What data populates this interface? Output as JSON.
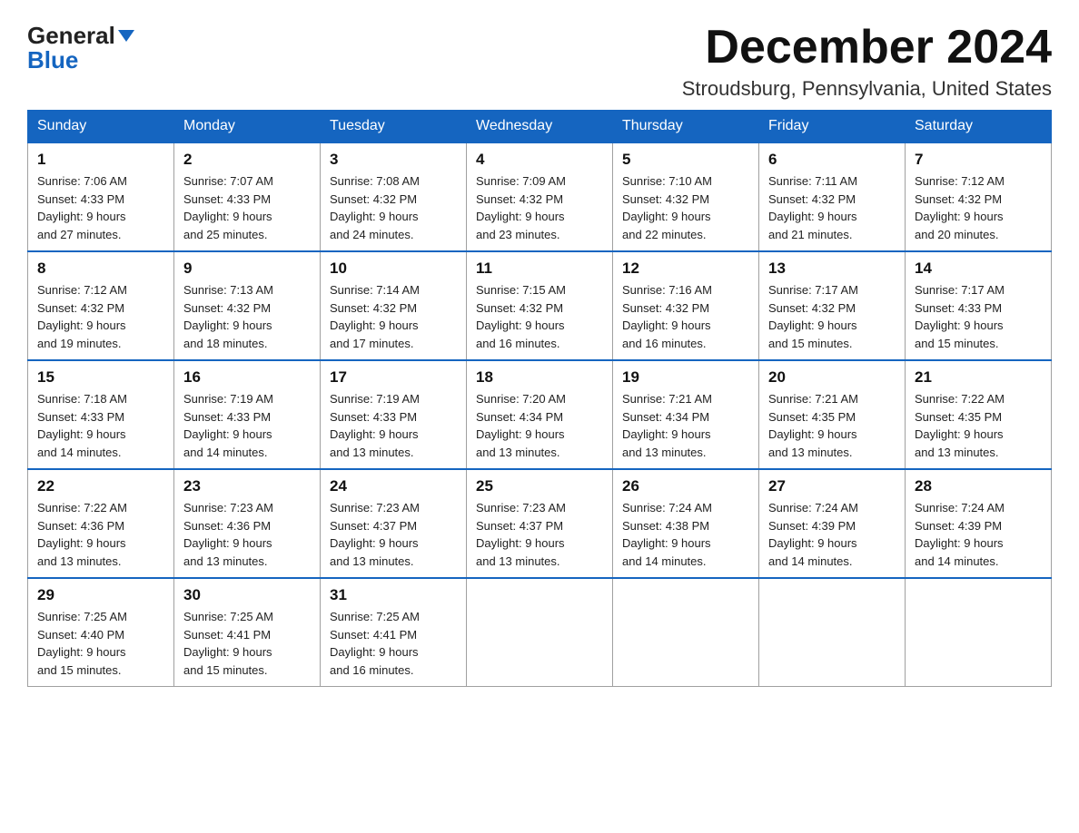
{
  "header": {
    "logo_line1": "General",
    "logo_line2": "Blue",
    "month_title": "December 2024",
    "location": "Stroudsburg, Pennsylvania, United States"
  },
  "weekdays": [
    "Sunday",
    "Monday",
    "Tuesday",
    "Wednesday",
    "Thursday",
    "Friday",
    "Saturday"
  ],
  "weeks": [
    [
      {
        "day": "1",
        "sunrise": "7:06 AM",
        "sunset": "4:33 PM",
        "daylight": "9 hours and 27 minutes."
      },
      {
        "day": "2",
        "sunrise": "7:07 AM",
        "sunset": "4:33 PM",
        "daylight": "9 hours and 25 minutes."
      },
      {
        "day": "3",
        "sunrise": "7:08 AM",
        "sunset": "4:32 PM",
        "daylight": "9 hours and 24 minutes."
      },
      {
        "day": "4",
        "sunrise": "7:09 AM",
        "sunset": "4:32 PM",
        "daylight": "9 hours and 23 minutes."
      },
      {
        "day": "5",
        "sunrise": "7:10 AM",
        "sunset": "4:32 PM",
        "daylight": "9 hours and 22 minutes."
      },
      {
        "day": "6",
        "sunrise": "7:11 AM",
        "sunset": "4:32 PM",
        "daylight": "9 hours and 21 minutes."
      },
      {
        "day": "7",
        "sunrise": "7:12 AM",
        "sunset": "4:32 PM",
        "daylight": "9 hours and 20 minutes."
      }
    ],
    [
      {
        "day": "8",
        "sunrise": "7:12 AM",
        "sunset": "4:32 PM",
        "daylight": "9 hours and 19 minutes."
      },
      {
        "day": "9",
        "sunrise": "7:13 AM",
        "sunset": "4:32 PM",
        "daylight": "9 hours and 18 minutes."
      },
      {
        "day": "10",
        "sunrise": "7:14 AM",
        "sunset": "4:32 PM",
        "daylight": "9 hours and 17 minutes."
      },
      {
        "day": "11",
        "sunrise": "7:15 AM",
        "sunset": "4:32 PM",
        "daylight": "9 hours and 16 minutes."
      },
      {
        "day": "12",
        "sunrise": "7:16 AM",
        "sunset": "4:32 PM",
        "daylight": "9 hours and 16 minutes."
      },
      {
        "day": "13",
        "sunrise": "7:17 AM",
        "sunset": "4:32 PM",
        "daylight": "9 hours and 15 minutes."
      },
      {
        "day": "14",
        "sunrise": "7:17 AM",
        "sunset": "4:33 PM",
        "daylight": "9 hours and 15 minutes."
      }
    ],
    [
      {
        "day": "15",
        "sunrise": "7:18 AM",
        "sunset": "4:33 PM",
        "daylight": "9 hours and 14 minutes."
      },
      {
        "day": "16",
        "sunrise": "7:19 AM",
        "sunset": "4:33 PM",
        "daylight": "9 hours and 14 minutes."
      },
      {
        "day": "17",
        "sunrise": "7:19 AM",
        "sunset": "4:33 PM",
        "daylight": "9 hours and 13 minutes."
      },
      {
        "day": "18",
        "sunrise": "7:20 AM",
        "sunset": "4:34 PM",
        "daylight": "9 hours and 13 minutes."
      },
      {
        "day": "19",
        "sunrise": "7:21 AM",
        "sunset": "4:34 PM",
        "daylight": "9 hours and 13 minutes."
      },
      {
        "day": "20",
        "sunrise": "7:21 AM",
        "sunset": "4:35 PM",
        "daylight": "9 hours and 13 minutes."
      },
      {
        "day": "21",
        "sunrise": "7:22 AM",
        "sunset": "4:35 PM",
        "daylight": "9 hours and 13 minutes."
      }
    ],
    [
      {
        "day": "22",
        "sunrise": "7:22 AM",
        "sunset": "4:36 PM",
        "daylight": "9 hours and 13 minutes."
      },
      {
        "day": "23",
        "sunrise": "7:23 AM",
        "sunset": "4:36 PM",
        "daylight": "9 hours and 13 minutes."
      },
      {
        "day": "24",
        "sunrise": "7:23 AM",
        "sunset": "4:37 PM",
        "daylight": "9 hours and 13 minutes."
      },
      {
        "day": "25",
        "sunrise": "7:23 AM",
        "sunset": "4:37 PM",
        "daylight": "9 hours and 13 minutes."
      },
      {
        "day": "26",
        "sunrise": "7:24 AM",
        "sunset": "4:38 PM",
        "daylight": "9 hours and 14 minutes."
      },
      {
        "day": "27",
        "sunrise": "7:24 AM",
        "sunset": "4:39 PM",
        "daylight": "9 hours and 14 minutes."
      },
      {
        "day": "28",
        "sunrise": "7:24 AM",
        "sunset": "4:39 PM",
        "daylight": "9 hours and 14 minutes."
      }
    ],
    [
      {
        "day": "29",
        "sunrise": "7:25 AM",
        "sunset": "4:40 PM",
        "daylight": "9 hours and 15 minutes."
      },
      {
        "day": "30",
        "sunrise": "7:25 AM",
        "sunset": "4:41 PM",
        "daylight": "9 hours and 15 minutes."
      },
      {
        "day": "31",
        "sunrise": "7:25 AM",
        "sunset": "4:41 PM",
        "daylight": "9 hours and 16 minutes."
      },
      null,
      null,
      null,
      null
    ]
  ]
}
